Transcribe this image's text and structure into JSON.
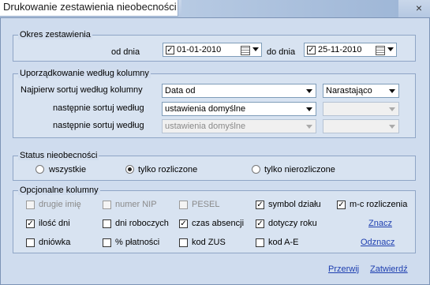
{
  "window": {
    "title": "Drukowanie zestawienia nieobecności",
    "close_icon": "×"
  },
  "okres": {
    "label": "Okres zestawienia",
    "from_label": "od dnia",
    "from_value": "01-01-2010",
    "from_checked": true,
    "to_label": "do dnia",
    "to_value": "25-11-2010",
    "to_checked": true
  },
  "sort": {
    "label": "Uporządkowanie według kolumny",
    "row1_label": "Najpierw sortuj według kolumny",
    "row1_value": "Data od",
    "row1_order": "Narastająco",
    "row2_label": "następnie sortuj według",
    "row2_value": "ustawienia domyślne",
    "row2_order": "",
    "row3_label": "następnie sortuj według",
    "row3_value": "ustawienia domyślne",
    "row3_order": ""
  },
  "status": {
    "label": "Status nieobecności",
    "options": [
      "wszystkie",
      "tylko rozliczone",
      "tylko nierozliczone"
    ],
    "selected": "tylko rozliczone"
  },
  "columns": {
    "label": "Opcjonalne kolumny",
    "items": [
      {
        "label": "drugie imię",
        "checked": false,
        "enabled": false
      },
      {
        "label": "numer NIP",
        "checked": false,
        "enabled": false
      },
      {
        "label": "PESEL",
        "checked": false,
        "enabled": false
      },
      {
        "label": "symbol działu",
        "checked": true,
        "enabled": true
      },
      {
        "label": "m-c rozliczenia",
        "checked": true,
        "enabled": true
      },
      {
        "label": "ilość dni",
        "checked": true,
        "enabled": true
      },
      {
        "label": "dni roboczych",
        "checked": false,
        "enabled": true
      },
      {
        "label": "czas absencji",
        "checked": true,
        "enabled": true
      },
      {
        "label": "dotyczy roku",
        "checked": true,
        "enabled": true
      },
      {
        "label": "dniówka",
        "checked": false,
        "enabled": true
      },
      {
        "label": "% płatności",
        "checked": false,
        "enabled": true
      },
      {
        "label": "kod ZUS",
        "checked": false,
        "enabled": true
      },
      {
        "label": "kod A-E",
        "checked": false,
        "enabled": true
      }
    ],
    "mark_link": "Znacz",
    "unmark_link": "Odznacz"
  },
  "actions": {
    "cancel": "Przerwij",
    "confirm": "Zatwierdź"
  }
}
